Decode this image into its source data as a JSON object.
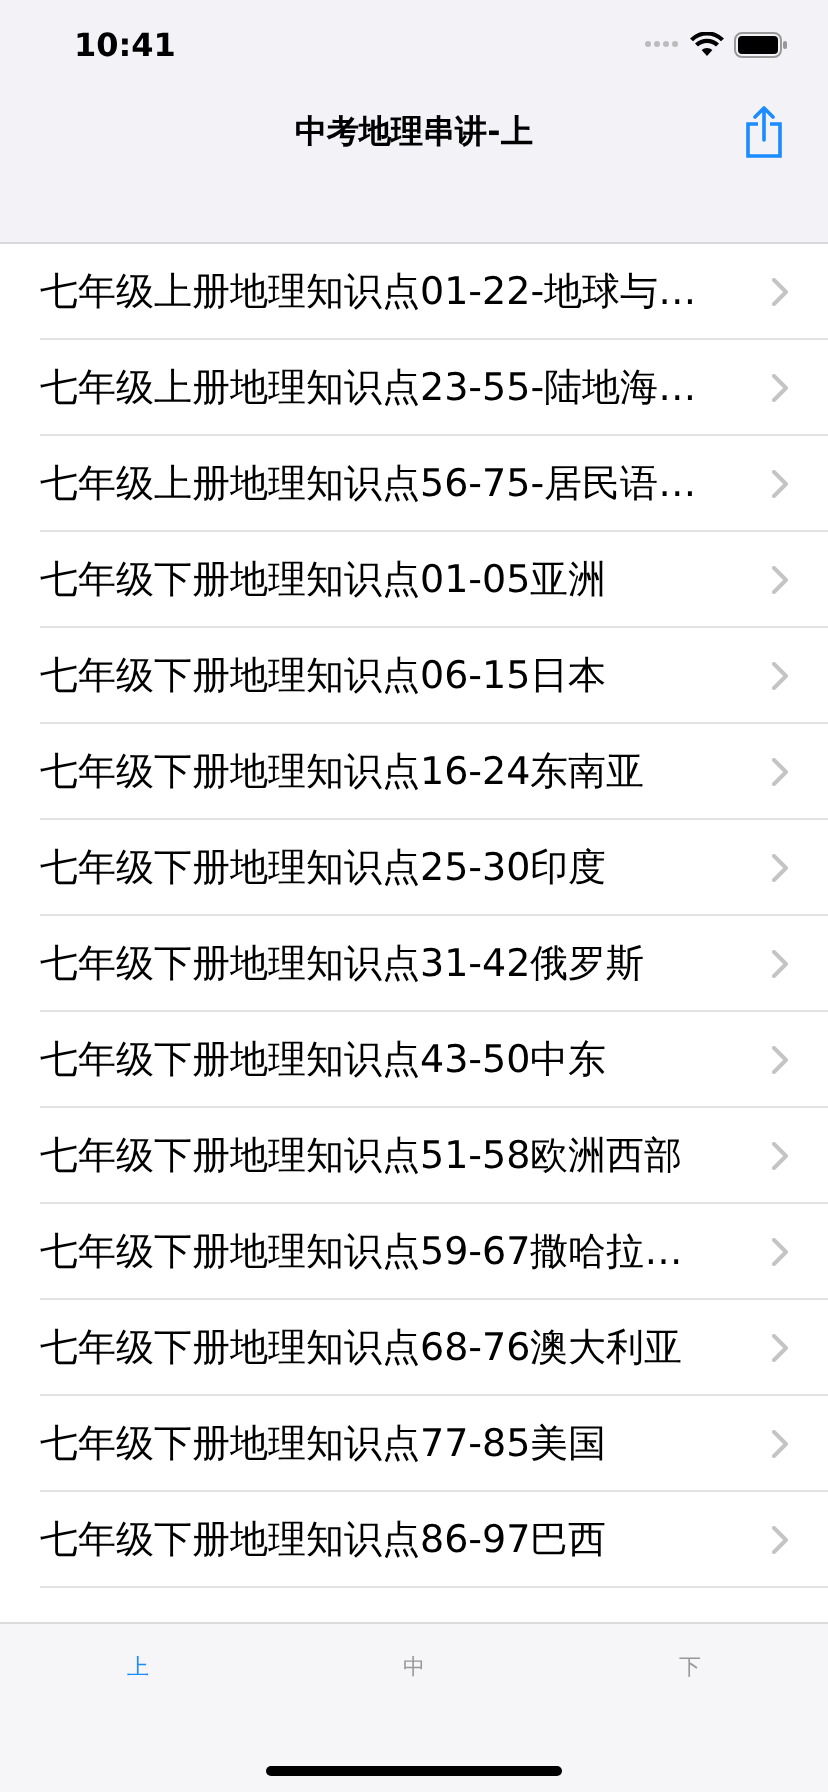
{
  "status_bar": {
    "time": "10:41"
  },
  "nav": {
    "title": "中考地理串讲-上"
  },
  "rows": [
    {
      "label": "七年级上册地理知识点01-22-地球与…"
    },
    {
      "label": "七年级上册地理知识点23-55-陆地海…"
    },
    {
      "label": "七年级上册地理知识点56-75-居民语…"
    },
    {
      "label": "七年级下册地理知识点01-05亚洲"
    },
    {
      "label": "七年级下册地理知识点06-15日本"
    },
    {
      "label": "七年级下册地理知识点16-24东南亚"
    },
    {
      "label": "七年级下册地理知识点25-30印度"
    },
    {
      "label": "七年级下册地理知识点31-42俄罗斯"
    },
    {
      "label": "七年级下册地理知识点43-50中东"
    },
    {
      "label": "七年级下册地理知识点51-58欧洲西部"
    },
    {
      "label": "七年级下册地理知识点59-67撒哈拉…"
    },
    {
      "label": "七年级下册地理知识点68-76澳大利亚"
    },
    {
      "label": "七年级下册地理知识点77-85美国"
    },
    {
      "label": "七年级下册地理知识点86-97巴西"
    }
  ],
  "tabs": [
    {
      "label": "上",
      "selected": true
    },
    {
      "label": "中",
      "selected": false
    },
    {
      "label": "下",
      "selected": false
    }
  ]
}
